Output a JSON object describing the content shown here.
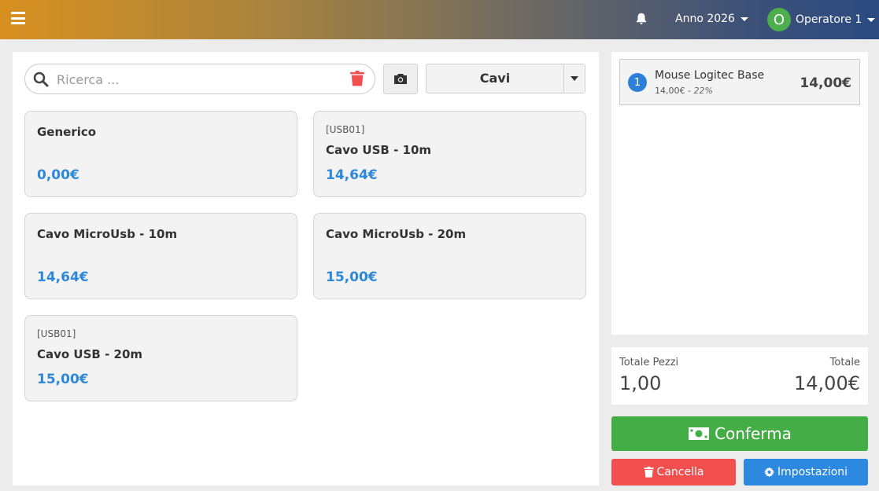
{
  "header": {
    "menu_icon": "hamburger-icon",
    "notification_icon": "bell-icon",
    "year_label": "Anno 2026",
    "operator_initial": "O",
    "operator_label": "Operatore 1"
  },
  "search": {
    "placeholder": "Ricerca ...",
    "value": ""
  },
  "category": {
    "selected": "Cavi"
  },
  "products": [
    {
      "code": "",
      "name": "Generico",
      "price": "0,00€"
    },
    {
      "code": "[USB01]",
      "name": "Cavo USB - 10m",
      "price": "14,64€"
    },
    {
      "code": "",
      "name": "Cavo MicroUsb - 10m",
      "price": "14,64€"
    },
    {
      "code": "",
      "name": "Cavo MicroUsb - 20m",
      "price": "15,00€"
    },
    {
      "code": "[USB01]",
      "name": "Cavo USB - 20m",
      "price": "15,00€"
    }
  ],
  "cart": {
    "items": [
      {
        "qty": "1",
        "name": "Mouse Logitec Base",
        "unit_price": "14,00€ - ",
        "vat": "22%",
        "total": "14,00€"
      }
    ]
  },
  "totals": {
    "pieces_label": "Totale Pezzi",
    "pieces_value": "1,00",
    "total_label": "Totale",
    "total_value": "14,00€"
  },
  "actions": {
    "confirm_label": "Conferma",
    "cancel_label": "Cancella",
    "settings_label": "Impostazioni"
  },
  "colors": {
    "price_blue": "#2d88d9",
    "confirm_green": "#45ad45",
    "cancel_red": "#f24f4f",
    "settings_blue": "#2d88e0"
  }
}
